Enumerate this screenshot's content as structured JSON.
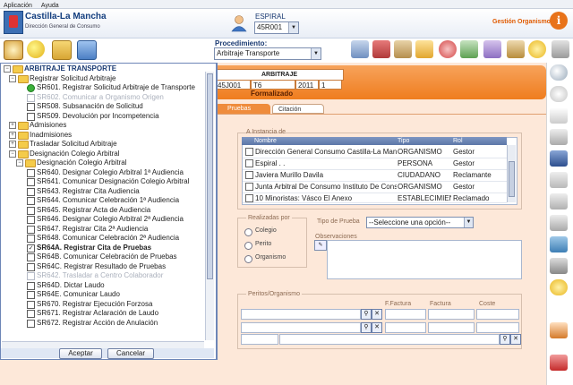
{
  "menu": {
    "items": [
      "Aplicación",
      "Ayuda"
    ]
  },
  "header": {
    "region_title": "Castilla-La Mancha",
    "region_subtitle": "Dirección General de Consumo",
    "user_label": "ESPIRAL",
    "user_value": "45R001",
    "module_label": "Gestión Organismo"
  },
  "procedure": {
    "label": "Procedimiento:",
    "value": "Arbitraje Transporte"
  },
  "arbitraje": {
    "header": "ARBITRAJE",
    "cells": [
      "45J001",
      "T6",
      "2011",
      "1"
    ],
    "status": "Formalizado"
  },
  "tabs": [
    {
      "label": "Pruebas",
      "active": true
    },
    {
      "label": "Citación",
      "active": false
    }
  ],
  "interested": {
    "group_label": "A Instancia de",
    "columns": [
      "Nombre",
      "Tipo",
      "Rol"
    ],
    "rows": [
      {
        "nombre": "Dirección General Consumo Castilla-La Mancha",
        "tipo": "ORGANISMO",
        "rol": "Gestor"
      },
      {
        "nombre": "Espiral . .",
        "tipo": "PERSONA",
        "rol": "Gestor"
      },
      {
        "nombre": "Javiera Murillo Davila",
        "tipo": "CIUDADANO",
        "rol": "Reclamante"
      },
      {
        "nombre": "Junta Arbitral De Consumo Instituto De Consumo",
        "tipo": "ORGANISMO",
        "rol": "Gestor"
      },
      {
        "nombre": "10 Minoristas: Vásco El Anexo",
        "tipo": "ESTABLECIMIENTO",
        "rol": "Reclamado"
      }
    ]
  },
  "realizadas": {
    "group_label": "Realizadas por",
    "options": [
      "Colegio",
      "Perito",
      "Organismo"
    ]
  },
  "tipo_prueba": {
    "label": "Tipo de Prueba",
    "value": "--Seleccione una opción--"
  },
  "observaciones": {
    "label": "Observaciones"
  },
  "peritos": {
    "group_label": "Peritos/Organismo",
    "columns": [
      "F.Factura",
      "Factura",
      "Coste"
    ]
  },
  "tree": {
    "items": [
      {
        "label": "ARBITRAJE TRANSPORTE",
        "kind": "root"
      },
      {
        "label": "Registrar Solicitud Arbitraje",
        "kind": "folder"
      },
      {
        "label": "SR601. Registrar Solicitud Arbitraje de Transporte",
        "kind": "done"
      },
      {
        "label": "SR602. Comunicar a Organismo Origen",
        "kind": "dim"
      },
      {
        "label": "SR508. Subsanación de Solicitud",
        "kind": "check"
      },
      {
        "label": "SR509. Devolución por Incompetencia",
        "kind": "check"
      },
      {
        "label": "Admisiones",
        "kind": "folder"
      },
      {
        "label": "Inadmisiones",
        "kind": "folder"
      },
      {
        "label": "Trasladar Solicitud Arbitraje",
        "kind": "folder"
      },
      {
        "label": "Designación Colegio Arbitral",
        "kind": "folder"
      },
      {
        "label": "Designación Colegio Arbitral",
        "kind": "folder2"
      },
      {
        "label": "SR640. Designar Colegio Arbitral 1ª Audiencia",
        "kind": "check"
      },
      {
        "label": "SR641. Comunicar Designación Colegio Arbitral",
        "kind": "check"
      },
      {
        "label": "SR643. Registrar Cita Audiencia",
        "kind": "check"
      },
      {
        "label": "SR644. Comunicar Celebración 1ª Audiencia",
        "kind": "check"
      },
      {
        "label": "SR645. Registrar Acta de Audiencia",
        "kind": "check"
      },
      {
        "label": "SR646. Designar Colegio Arbitral 2ª Audiencia",
        "kind": "check"
      },
      {
        "label": "SR647. Registrar Cita 2ª Audiencia",
        "kind": "check"
      },
      {
        "label": "SR648. Comunicar Celebración 2ª Audiencia",
        "kind": "check"
      },
      {
        "label": "SR64A. Registrar Cita de Pruebas",
        "kind": "checked"
      },
      {
        "label": "SR64B. Comunicar Celebración de Pruebas",
        "kind": "check"
      },
      {
        "label": "SR64C. Registrar Resultado de Pruebas",
        "kind": "check"
      },
      {
        "label": "SR642. Trasladar a Centro Colaborador",
        "kind": "dim"
      },
      {
        "label": "SR64D. Dictar Laudo",
        "kind": "check"
      },
      {
        "label": "SR64E. Comunicar Laudo",
        "kind": "check"
      },
      {
        "label": "SR670. Registrar Ejecución Forzosa",
        "kind": "check"
      },
      {
        "label": "SR671. Registrar Aclaración de Laudo",
        "kind": "check"
      },
      {
        "label": "SR672. Registrar Acción de Anulación",
        "kind": "check"
      }
    ],
    "accept_label": "Aceptar",
    "cancel_label": "Cancelar"
  },
  "colors": {
    "accent_orange": "#ef7d1e",
    "brand_blue": "#143f7f",
    "panel_peach": "#fde8d9"
  }
}
